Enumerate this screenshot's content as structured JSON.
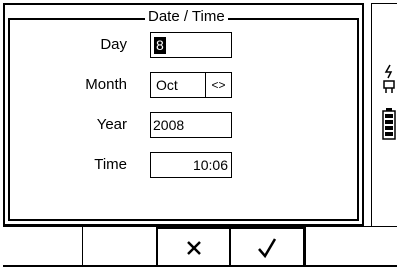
{
  "dialog": {
    "title": "Date / Time",
    "fields": {
      "day": {
        "label": "Day",
        "value": "8"
      },
      "month": {
        "label": "Month",
        "value": "Oct",
        "toggle": "<>"
      },
      "year": {
        "label": "Year",
        "value": "2008"
      },
      "time": {
        "label": "Time",
        "value": "10:06"
      }
    }
  },
  "softkeys": {
    "cancel": "×",
    "confirm": "✓"
  },
  "status_icons": [
    "plug-icon",
    "battery-icon"
  ]
}
